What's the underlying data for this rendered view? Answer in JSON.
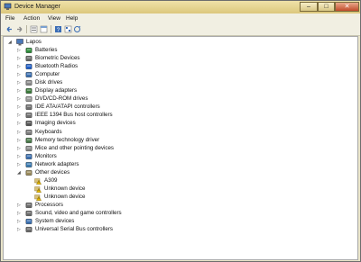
{
  "window": {
    "title": "Device Manager"
  },
  "title_buttons": {
    "minimize": "–",
    "maximize": "□",
    "close": "✕"
  },
  "menu": [
    "File",
    "Action",
    "View",
    "Help"
  ],
  "tree": {
    "root": "Lapos",
    "categories": [
      {
        "label": "Batteries",
        "icon": "battery-icon",
        "color": "#2e8b3a"
      },
      {
        "label": "Biometric Devices",
        "icon": "biometric-icon",
        "color": "#6a6a6a"
      },
      {
        "label": "Bluetooth Radios",
        "icon": "bluetooth-icon",
        "color": "#1f5fc9"
      },
      {
        "label": "Computer",
        "icon": "computer-icon",
        "color": "#3a6fb0"
      },
      {
        "label": "Disk drives",
        "icon": "disk-drive-icon",
        "color": "#8a8a8a"
      },
      {
        "label": "Display adapters",
        "icon": "display-adapter-icon",
        "color": "#3a7a3a"
      },
      {
        "label": "DVD/CD-ROM drives",
        "icon": "dvd-drive-icon",
        "color": "#9a9a9a"
      },
      {
        "label": "IDE ATA/ATAPI controllers",
        "icon": "ide-controller-icon",
        "color": "#6f6f6f"
      },
      {
        "label": "IEEE 1394 Bus host controllers",
        "icon": "ieee1394-icon",
        "color": "#6f6f6f"
      },
      {
        "label": "Imaging devices",
        "icon": "camera-icon",
        "color": "#555555"
      },
      {
        "label": "Keyboards",
        "icon": "keyboard-icon",
        "color": "#7a7a7a"
      },
      {
        "label": "Memory technology driver",
        "icon": "memory-icon",
        "color": "#4a7a4a"
      },
      {
        "label": "Mice and other pointing devices",
        "icon": "mouse-icon",
        "color": "#8a8a8a"
      },
      {
        "label": "Monitors",
        "icon": "monitor-icon",
        "color": "#3a6fb0"
      },
      {
        "label": "Network adapters",
        "icon": "network-adapter-icon",
        "color": "#3a7ab0"
      },
      {
        "label": "Other devices",
        "icon": "other-devices-icon",
        "color": "#9a8a5a",
        "expanded": true,
        "children": [
          {
            "label": "A309",
            "icon": "unknown-device-warning-icon"
          },
          {
            "label": "Unknown device",
            "icon": "unknown-device-warning-icon"
          },
          {
            "label": "Unknown device",
            "icon": "unknown-device-warning-icon"
          }
        ]
      },
      {
        "label": "Processors",
        "icon": "processor-icon",
        "color": "#6a6a6a"
      },
      {
        "label": "Sound, video and game controllers",
        "icon": "sound-icon",
        "color": "#6a6a6a"
      },
      {
        "label": "System devices",
        "icon": "system-devices-icon",
        "color": "#3a6fb0"
      },
      {
        "label": "Universal Serial Bus controllers",
        "icon": "usb-icon",
        "color": "#6a6a6a"
      }
    ]
  }
}
